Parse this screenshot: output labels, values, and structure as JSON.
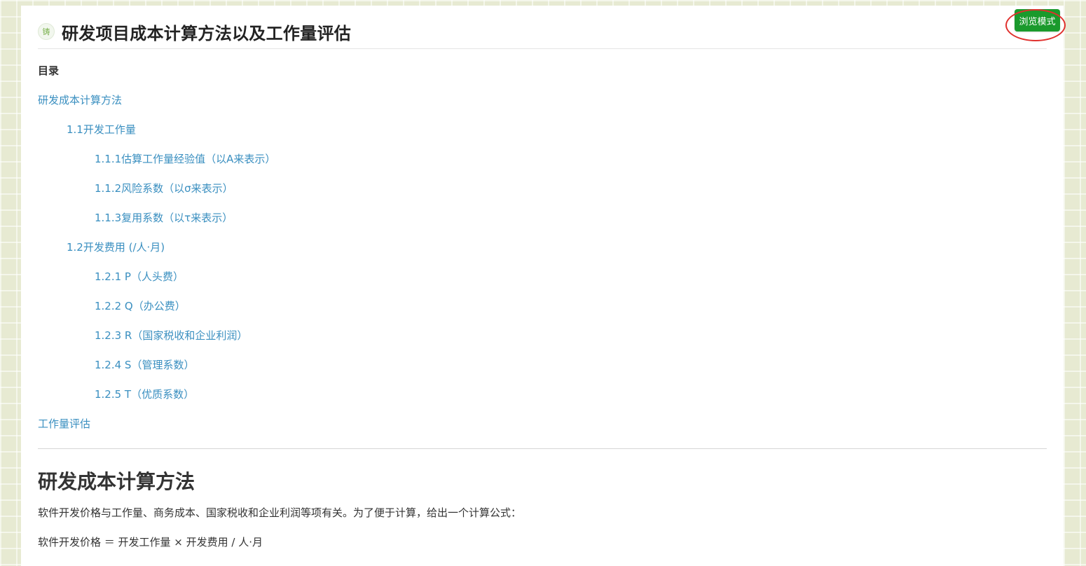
{
  "page": {
    "title_badge": "铸",
    "title": "研发项目成本计算方法以及工作量评估",
    "mode_button": "浏览模式"
  },
  "toc": {
    "heading": "目录",
    "items": [
      {
        "label": "研发成本计算方法",
        "level": 1
      },
      {
        "label": "1.1开发工作量",
        "level": 2
      },
      {
        "label": "1.1.1估算工作量经验值（以A来表示）",
        "level": 3
      },
      {
        "label": "1.1.2风险系数（以σ来表示）",
        "level": 3
      },
      {
        "label": "1.1.3复用系数（以τ来表示）",
        "level": 3
      },
      {
        "label": "1.2开发费用 (/人·月)",
        "level": 2
      },
      {
        "label": "1.2.1 P（人头费）",
        "level": 3
      },
      {
        "label": "1.2.2 Q（办公费）",
        "level": 3
      },
      {
        "label": "1.2.3 R（国家税收和企业利润）",
        "level": 3
      },
      {
        "label": "1.2.4 S（管理系数）",
        "level": 3
      },
      {
        "label": "1.2.5 T（优质系数）",
        "level": 3
      },
      {
        "label": "工作量评估",
        "level": 1
      }
    ]
  },
  "content": {
    "section_title": "研发成本计算方法",
    "paragraph1": "软件开发价格与工作量、商务成本、国家税收和企业利润等项有关。为了便于计算，给出一个计算公式：",
    "paragraph2": "软件开发价格 ＝ 开发工作量 × 开发费用 / 人·月"
  },
  "colors": {
    "link": "#3a8fc0",
    "button": "#1a9a2c",
    "highlight_ring": "#e0302d",
    "background": "#e7ead2"
  }
}
